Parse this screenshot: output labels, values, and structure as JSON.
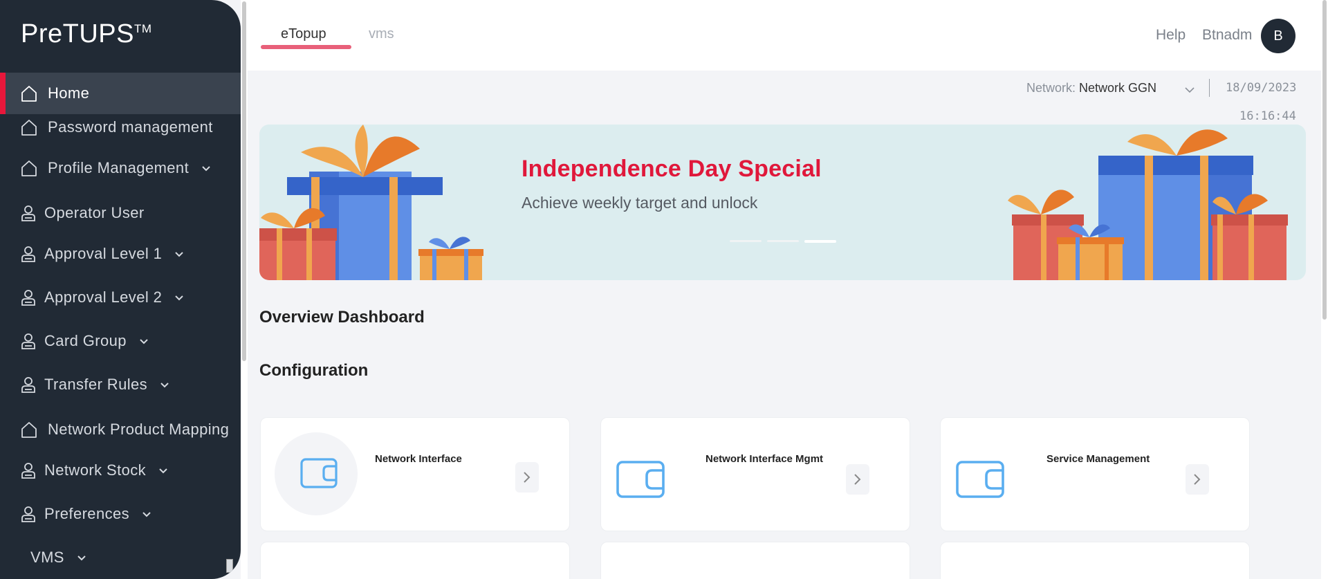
{
  "app": {
    "logo": "PreTUPS",
    "logo_tm": "TM"
  },
  "sidebar": {
    "items": [
      {
        "label": "Home",
        "icon": "home-icon",
        "active": true
      },
      {
        "label": "Password management",
        "icon": "home-icon"
      },
      {
        "label": "Profile Management",
        "icon": "home-icon",
        "expandable": true
      },
      {
        "label": "Operator User",
        "icon": "user-icon"
      },
      {
        "label": "Approval Level 1",
        "icon": "user-icon",
        "expandable": true
      },
      {
        "label": "Approval Level 2",
        "icon": "user-icon",
        "expandable": true
      },
      {
        "label": "Card Group",
        "icon": "user-icon",
        "expandable": true
      },
      {
        "label": "Transfer Rules",
        "icon": "user-icon",
        "expandable": true
      },
      {
        "label": "Network Product Mapping",
        "icon": "home-icon"
      },
      {
        "label": "Network Stock",
        "icon": "user-icon",
        "expandable": true
      },
      {
        "label": "Preferences",
        "icon": "user-icon",
        "expandable": true
      },
      {
        "label": "VMS",
        "icon": "",
        "expandable": true
      }
    ]
  },
  "header": {
    "tabs": [
      {
        "label": "eTopup",
        "active": true
      },
      {
        "label": "vms"
      }
    ],
    "help": "Help",
    "username": "Btnadm",
    "avatar_initial": "B"
  },
  "network": {
    "label": "Network:",
    "value": "Network GGN",
    "date": "18/09/2023",
    "time": "16:16:44"
  },
  "banner": {
    "title": "Independence Day Special",
    "subtitle": "Achieve weekly target and unlock",
    "active_slide": 3,
    "slides": 3
  },
  "sections": {
    "overview": "Overview Dashboard",
    "configuration": "Configuration"
  },
  "cards": [
    {
      "title": "Network Interface",
      "icon": "wallet-icon"
    },
    {
      "title": "Network Interface Mgmt",
      "icon": "wallet-icon"
    },
    {
      "title": "Service Management",
      "icon": "wallet-icon"
    }
  ],
  "colors": {
    "sidebar": "#212a35",
    "accent": "#e8173b",
    "banner_bg": "#dcedef",
    "icon_blue": "#5aaef0"
  }
}
